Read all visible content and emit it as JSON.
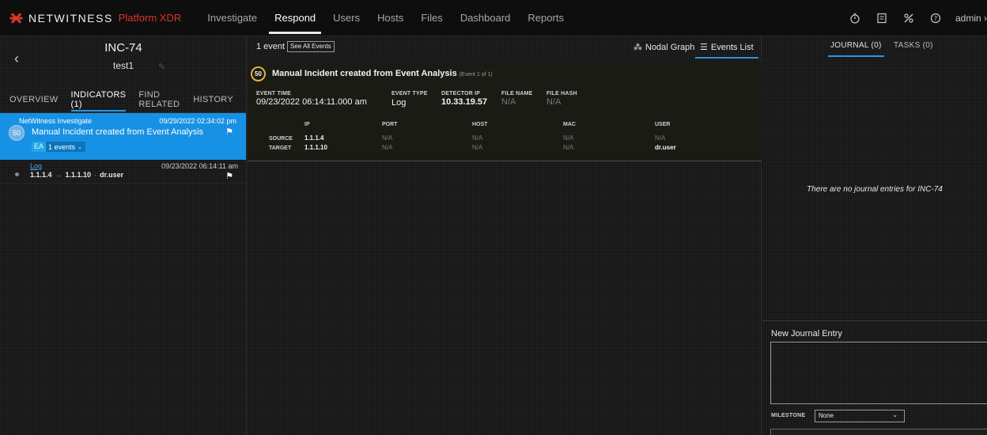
{
  "header": {
    "brand": "NETWITNESS",
    "brand_sub": "Platform XDR",
    "nav": [
      "Investigate",
      "Respond",
      "Users",
      "Hosts",
      "Files",
      "Dashboard",
      "Reports"
    ],
    "active_nav": "Respond",
    "icons": [
      "stopwatch-icon",
      "notes-icon",
      "tools-icon",
      "help-icon"
    ],
    "user": "admin"
  },
  "incident": {
    "id": "INC-74",
    "name": "test1",
    "tabs": [
      "OVERVIEW",
      "INDICATORS (1)",
      "FIND RELATED",
      "HISTORY"
    ],
    "active_tab": "INDICATORS (1)",
    "indicator": {
      "source": "NetWitness Investigate",
      "date": "09/29/2022 02:34:02 pm",
      "score": "50",
      "title": "Manual Incident created from Event Analysis",
      "tag": "EA",
      "events": "1 events"
    },
    "event": {
      "type": "Log",
      "date": "09/23/2022 06:14:11 am",
      "source_ip": "1.1.1.4",
      "target_ip": "1.1.1.10",
      "user": "dr.user"
    }
  },
  "events": {
    "count": "1 event",
    "see_all": "See All Events",
    "nodal_graph": "Nodal Graph",
    "events_list": "Events List",
    "card": {
      "score": "50",
      "title": "Manual Incident created from Event Analysis",
      "of": "(Event 1 of 1)",
      "fields": {
        "event_time_label": "EVENT TIME",
        "event_time": "09/23/2022 06:14:11.000 am",
        "event_type_label": "EVENT TYPE",
        "event_type": "Log",
        "detector_ip_label": "DETECTOR IP",
        "detector_ip": "10.33.19.57",
        "file_name_label": "FILE NAME",
        "file_name": "N/A",
        "file_hash_label": "FILE HASH",
        "file_hash": "N/A"
      },
      "columns": [
        "IP",
        "PORT",
        "HOST",
        "MAC",
        "USER"
      ],
      "rows": [
        {
          "label": "SOURCE",
          "ip": "1.1.1.4",
          "port": "N/A",
          "host": "N/A",
          "mac": "N/A",
          "user": "N/A"
        },
        {
          "label": "TARGET",
          "ip": "1.1.1.10",
          "port": "N/A",
          "host": "N/A",
          "mac": "N/A",
          "user": "dr.user"
        }
      ]
    }
  },
  "journal": {
    "tab_journal": "JOURNAL (0)",
    "tab_tasks": "TASKS (0)",
    "empty": "There are no journal entries for INC-74",
    "new_entry": "New Journal Entry",
    "milestone_label": "MILESTONE",
    "milestone_value": "None"
  }
}
